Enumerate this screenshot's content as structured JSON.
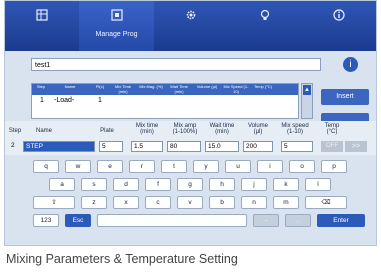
{
  "nav": {
    "items": [
      {
        "icon": "grid-icon",
        "label": ""
      },
      {
        "icon": "program-icon",
        "label": "Manage Prog"
      },
      {
        "icon": "gear-icon",
        "label": ""
      },
      {
        "icon": "bulb-icon",
        "label": ""
      },
      {
        "icon": "info-icon",
        "label": ""
      }
    ]
  },
  "file_name": "test1",
  "info_button": "i",
  "table": {
    "headers": [
      "Step",
      "Name",
      "Pl(x)",
      "Mix Time (min)",
      "Mix Mag. (%)",
      "Wait Time (min)",
      "Volume (µl)",
      "Mix Speed (1-10)",
      "Temp (°C)"
    ],
    "rows": [
      {
        "step": "1",
        "name": "-Load-",
        "plate": "1"
      }
    ]
  },
  "side_buttons": {
    "insert": "Insert"
  },
  "editor": {
    "labels": {
      "step": "Step",
      "name": "Name",
      "plate": "Plate",
      "mix_time": "Mix time\n(min)",
      "mix_amp": "Mix amp\n(1-100%)",
      "wait_time": "Wait time\n(min)",
      "volume": "Volume\n(µl)",
      "mix_speed": "Mix speed\n(1-10)",
      "temp": "Temp\n(°C)"
    },
    "values": {
      "step": "2",
      "name": "STEP",
      "plate": "5",
      "mix_time": "1.5",
      "mix_amp": "80",
      "wait_time": "15.0",
      "volume": "200",
      "mix_speed": "5",
      "temp": "OFF"
    },
    "next_label": ">>"
  },
  "keyboard": {
    "row1": [
      "q",
      "w",
      "e",
      "r",
      "t",
      "y",
      "u",
      "i",
      "o",
      "p"
    ],
    "row2": [
      "a",
      "s",
      "d",
      "f",
      "g",
      "h",
      "j",
      "k",
      "l"
    ],
    "row3": [
      "⇧",
      "z",
      "x",
      "c",
      "v",
      "b",
      "n",
      "m",
      "⌫"
    ],
    "num_key": "123",
    "esc_key": "Esc",
    "space_key": "",
    "dash_key": "-",
    "dot_key": ".",
    "enter_key": "Enter"
  },
  "caption": "Mixing Parameters & Temperature Setting",
  "colors": {
    "accent": "#2c5ab8",
    "nav": "#1c3b8f",
    "panel": "#d8e3ef"
  }
}
